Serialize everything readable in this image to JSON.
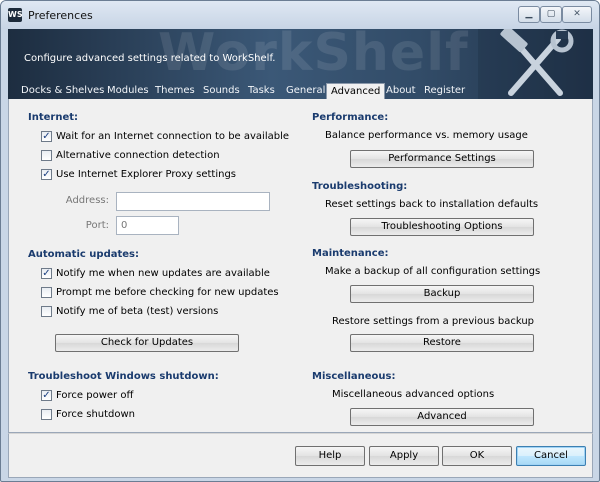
{
  "window": {
    "title": "Preferences",
    "app_icon": "WS"
  },
  "banner": {
    "text": "Configure advanced settings related to WorkShelf.",
    "watermark": "WorkShelf"
  },
  "tabs": [
    {
      "label": "Docks & Shelves"
    },
    {
      "label": "Modules"
    },
    {
      "label": "Themes"
    },
    {
      "label": "Sounds"
    },
    {
      "label": "Tasks"
    },
    {
      "label": "General"
    },
    {
      "label": "Advanced",
      "active": true
    },
    {
      "label": "About"
    },
    {
      "label": "Register"
    }
  ],
  "internet": {
    "title": "Internet:",
    "options": [
      {
        "label": "Wait for an Internet connection to be available",
        "checked": true
      },
      {
        "label": "Alternative connection detection",
        "checked": false
      },
      {
        "label": "Use Internet Explorer Proxy settings",
        "checked": true
      }
    ],
    "address_label": "Address:",
    "address_value": "",
    "port_label": "Port:",
    "port_value": "0"
  },
  "updates": {
    "title": "Automatic updates:",
    "options": [
      {
        "label": "Notify me when new updates are available",
        "checked": true
      },
      {
        "label": "Prompt me before checking for new updates",
        "checked": false
      },
      {
        "label": "Notify me of beta (test) versions",
        "checked": false
      }
    ],
    "button": "Check for Updates"
  },
  "shutdown": {
    "title": "Troubleshoot Windows shutdown:",
    "options": [
      {
        "label": "Force power off",
        "checked": true
      },
      {
        "label": "Force shutdown",
        "checked": false
      }
    ]
  },
  "performance": {
    "title": "Performance:",
    "desc": "Balance performance vs. memory usage",
    "button": "Performance Settings"
  },
  "troubleshooting": {
    "title": "Troubleshooting:",
    "desc": "Reset settings back to installation defaults",
    "button": "Troubleshooting Options"
  },
  "maintenance": {
    "title": "Maintenance:",
    "backup_desc": "Make a backup of all configuration settings",
    "backup_button": "Backup",
    "restore_desc": "Restore settings from a previous backup",
    "restore_button": "Restore"
  },
  "misc": {
    "title": "Miscellaneous:",
    "desc": "Miscellaneous advanced options",
    "button": "Advanced"
  },
  "footer": {
    "help": "Help",
    "apply": "Apply",
    "ok": "OK",
    "cancel": "Cancel"
  },
  "check_mark": "✓",
  "colors": {
    "accent": "#1a3b6e",
    "banner": "#324c68",
    "default_button": "#3c7fb1"
  }
}
